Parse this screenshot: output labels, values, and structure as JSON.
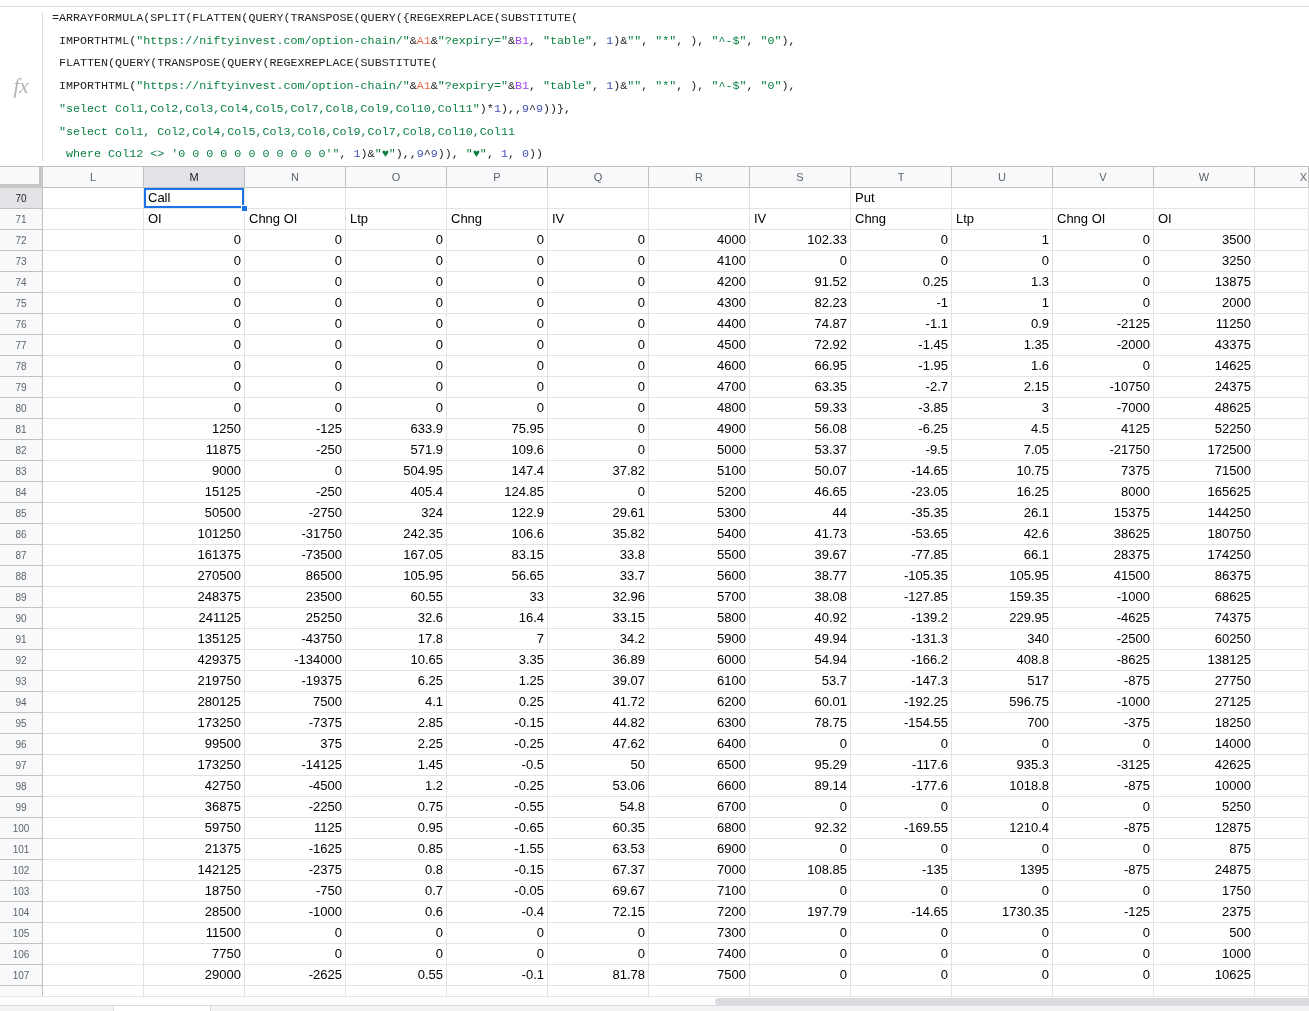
{
  "formula_bar": {
    "label": "fx",
    "lines": [
      "=ARRAYFORMULA(SPLIT(FLATTEN(QUERY(TRANSPOSE(QUERY({REGEXREPLACE(SUBSTITUTE(",
      " IMPORTHTML(\"https://niftyinvest.com/option-chain/\"&A1&\"?expiry=\"&B1, \"table\", 1)&\"\", \"*\", ), \"^-$\", \"0\"),",
      " FLATTEN(QUERY(TRANSPOSE(QUERY(REGEXREPLACE(SUBSTITUTE(",
      " IMPORTHTML(\"https://niftyinvest.com/option-chain/\"&A1&\"?expiry=\"&B1, \"table\", 1)&\"\", \"*\", ), \"^-$\", \"0\"),",
      " \"select Col1,Col2,Col3,Col4,Col5,Col7,Col8,Col9,Col10,Col11\")*1),,9^9))},",
      " \"select Col1, Col2,Col4,Col5,Col3,Col6,Col9,Col7,Col8,Col10,Col11",
      "  where Col12 <> '0 0 0 0 0 0 0 0 0 0 0'\", 1)&\"♥\"),,9^9)), \"♥\", 1, 0))"
    ]
  },
  "sheet": {
    "columns": [
      {
        "label": "L",
        "selected": false
      },
      {
        "label": "M",
        "selected": true
      },
      {
        "label": "N",
        "selected": false
      },
      {
        "label": "O",
        "selected": false
      },
      {
        "label": "P",
        "selected": false
      },
      {
        "label": "Q",
        "selected": false
      },
      {
        "label": "R",
        "selected": false
      },
      {
        "label": "S",
        "selected": false
      },
      {
        "label": "T",
        "selected": false
      },
      {
        "label": "U",
        "selected": false
      },
      {
        "label": "V",
        "selected": false
      },
      {
        "label": "W",
        "selected": false
      },
      {
        "label": "X",
        "selected": false
      }
    ],
    "rows": [
      {
        "label": "70",
        "selected": true,
        "kind": "header",
        "cells": [
          null,
          "Call",
          null,
          null,
          null,
          null,
          null,
          null,
          "Put",
          null,
          null,
          null
        ]
      },
      {
        "label": "71",
        "selected": false,
        "kind": "header",
        "cells": [
          null,
          "OI",
          "Chng OI",
          "Ltp",
          "Chng",
          "IV",
          null,
          "IV",
          "Chng",
          "Ltp",
          "Chng OI",
          "OI"
        ]
      },
      {
        "label": "72",
        "selected": false,
        "kind": "data",
        "cells": [
          null,
          "0",
          "0",
          "0",
          "0",
          "0",
          "4000",
          "102.33",
          "0",
          "1",
          "0",
          "3500"
        ]
      },
      {
        "label": "73",
        "selected": false,
        "kind": "data",
        "cells": [
          null,
          "0",
          "0",
          "0",
          "0",
          "0",
          "4100",
          "0",
          "0",
          "0",
          "0",
          "3250"
        ]
      },
      {
        "label": "74",
        "selected": false,
        "kind": "data",
        "cells": [
          null,
          "0",
          "0",
          "0",
          "0",
          "0",
          "4200",
          "91.52",
          "0.25",
          "1.3",
          "0",
          "13875"
        ]
      },
      {
        "label": "75",
        "selected": false,
        "kind": "data",
        "cells": [
          null,
          "0",
          "0",
          "0",
          "0",
          "0",
          "4300",
          "82.23",
          "-1",
          "1",
          "0",
          "2000"
        ]
      },
      {
        "label": "76",
        "selected": false,
        "kind": "data",
        "cells": [
          null,
          "0",
          "0",
          "0",
          "0",
          "0",
          "4400",
          "74.87",
          "-1.1",
          "0.9",
          "-2125",
          "11250"
        ]
      },
      {
        "label": "77",
        "selected": false,
        "kind": "data",
        "cells": [
          null,
          "0",
          "0",
          "0",
          "0",
          "0",
          "4500",
          "72.92",
          "-1.45",
          "1.35",
          "-2000",
          "43375"
        ]
      },
      {
        "label": "78",
        "selected": false,
        "kind": "data",
        "cells": [
          null,
          "0",
          "0",
          "0",
          "0",
          "0",
          "4600",
          "66.95",
          "-1.95",
          "1.6",
          "0",
          "14625"
        ]
      },
      {
        "label": "79",
        "selected": false,
        "kind": "data",
        "cells": [
          null,
          "0",
          "0",
          "0",
          "0",
          "0",
          "4700",
          "63.35",
          "-2.7",
          "2.15",
          "-10750",
          "24375"
        ]
      },
      {
        "label": "80",
        "selected": false,
        "kind": "data",
        "cells": [
          null,
          "0",
          "0",
          "0",
          "0",
          "0",
          "4800",
          "59.33",
          "-3.85",
          "3",
          "-7000",
          "48625"
        ]
      },
      {
        "label": "81",
        "selected": false,
        "kind": "data",
        "cells": [
          null,
          "1250",
          "-125",
          "633.9",
          "75.95",
          "0",
          "4900",
          "56.08",
          "-6.25",
          "4.5",
          "4125",
          "52250"
        ]
      },
      {
        "label": "82",
        "selected": false,
        "kind": "data",
        "cells": [
          null,
          "11875",
          "-250",
          "571.9",
          "109.6",
          "0",
          "5000",
          "53.37",
          "-9.5",
          "7.05",
          "-21750",
          "172500"
        ]
      },
      {
        "label": "83",
        "selected": false,
        "kind": "data",
        "cells": [
          null,
          "9000",
          "0",
          "504.95",
          "147.4",
          "37.82",
          "5100",
          "50.07",
          "-14.65",
          "10.75",
          "7375",
          "71500"
        ]
      },
      {
        "label": "84",
        "selected": false,
        "kind": "data",
        "cells": [
          null,
          "15125",
          "-250",
          "405.4",
          "124.85",
          "0",
          "5200",
          "46.65",
          "-23.05",
          "16.25",
          "8000",
          "165625"
        ]
      },
      {
        "label": "85",
        "selected": false,
        "kind": "data",
        "cells": [
          null,
          "50500",
          "-2750",
          "324",
          "122.9",
          "29.61",
          "5300",
          "44",
          "-35.35",
          "26.1",
          "15375",
          "144250"
        ]
      },
      {
        "label": "86",
        "selected": false,
        "kind": "data",
        "cells": [
          null,
          "101250",
          "-31750",
          "242.35",
          "106.6",
          "35.82",
          "5400",
          "41.73",
          "-53.65",
          "42.6",
          "38625",
          "180750"
        ]
      },
      {
        "label": "87",
        "selected": false,
        "kind": "data",
        "cells": [
          null,
          "161375",
          "-73500",
          "167.05",
          "83.15",
          "33.8",
          "5500",
          "39.67",
          "-77.85",
          "66.1",
          "28375",
          "174250"
        ]
      },
      {
        "label": "88",
        "selected": false,
        "kind": "data",
        "cells": [
          null,
          "270500",
          "86500",
          "105.95",
          "56.65",
          "33.7",
          "5600",
          "38.77",
          "-105.35",
          "105.95",
          "41500",
          "86375"
        ]
      },
      {
        "label": "89",
        "selected": false,
        "kind": "data",
        "cells": [
          null,
          "248375",
          "23500",
          "60.55",
          "33",
          "32.96",
          "5700",
          "38.08",
          "-127.85",
          "159.35",
          "-1000",
          "68625"
        ]
      },
      {
        "label": "90",
        "selected": false,
        "kind": "data",
        "cells": [
          null,
          "241125",
          "25250",
          "32.6",
          "16.4",
          "33.15",
          "5800",
          "40.92",
          "-139.2",
          "229.95",
          "-4625",
          "74375"
        ]
      },
      {
        "label": "91",
        "selected": false,
        "kind": "data",
        "cells": [
          null,
          "135125",
          "-43750",
          "17.8",
          "7",
          "34.2",
          "5900",
          "49.94",
          "-131.3",
          "340",
          "-2500",
          "60250"
        ]
      },
      {
        "label": "92",
        "selected": false,
        "kind": "data",
        "cells": [
          null,
          "429375",
          "-134000",
          "10.65",
          "3.35",
          "36.89",
          "6000",
          "54.94",
          "-166.2",
          "408.8",
          "-8625",
          "138125"
        ]
      },
      {
        "label": "93",
        "selected": false,
        "kind": "data",
        "cells": [
          null,
          "219750",
          "-19375",
          "6.25",
          "1.25",
          "39.07",
          "6100",
          "53.7",
          "-147.3",
          "517",
          "-875",
          "27750"
        ]
      },
      {
        "label": "94",
        "selected": false,
        "kind": "data",
        "cells": [
          null,
          "280125",
          "7500",
          "4.1",
          "0.25",
          "41.72",
          "6200",
          "60.01",
          "-192.25",
          "596.75",
          "-1000",
          "27125"
        ]
      },
      {
        "label": "95",
        "selected": false,
        "kind": "data",
        "cells": [
          null,
          "173250",
          "-7375",
          "2.85",
          "-0.15",
          "44.82",
          "6300",
          "78.75",
          "-154.55",
          "700",
          "-375",
          "18250"
        ]
      },
      {
        "label": "96",
        "selected": false,
        "kind": "data",
        "cells": [
          null,
          "99500",
          "375",
          "2.25",
          "-0.25",
          "47.62",
          "6400",
          "0",
          "0",
          "0",
          "0",
          "14000"
        ]
      },
      {
        "label": "97",
        "selected": false,
        "kind": "data",
        "cells": [
          null,
          "173250",
          "-14125",
          "1.45",
          "-0.5",
          "50",
          "6500",
          "95.29",
          "-117.6",
          "935.3",
          "-3125",
          "42625"
        ]
      },
      {
        "label": "98",
        "selected": false,
        "kind": "data",
        "cells": [
          null,
          "42750",
          "-4500",
          "1.2",
          "-0.25",
          "53.06",
          "6600",
          "89.14",
          "-177.6",
          "1018.8",
          "-875",
          "10000"
        ]
      },
      {
        "label": "99",
        "selected": false,
        "kind": "data",
        "cells": [
          null,
          "36875",
          "-2250",
          "0.75",
          "-0.55",
          "54.8",
          "6700",
          "0",
          "0",
          "0",
          "0",
          "5250"
        ]
      },
      {
        "label": "100",
        "selected": false,
        "kind": "data",
        "cells": [
          null,
          "59750",
          "1125",
          "0.95",
          "-0.65",
          "60.35",
          "6800",
          "92.32",
          "-169.55",
          "1210.4",
          "-875",
          "12875"
        ]
      },
      {
        "label": "101",
        "selected": false,
        "kind": "data",
        "cells": [
          null,
          "21375",
          "-1625",
          "0.85",
          "-1.55",
          "63.53",
          "6900",
          "0",
          "0",
          "0",
          "0",
          "875"
        ]
      },
      {
        "label": "102",
        "selected": false,
        "kind": "data",
        "cells": [
          null,
          "142125",
          "-2375",
          "0.8",
          "-0.15",
          "67.37",
          "7000",
          "108.85",
          "-135",
          "1395",
          "-875",
          "24875"
        ]
      },
      {
        "label": "103",
        "selected": false,
        "kind": "data",
        "cells": [
          null,
          "18750",
          "-750",
          "0.7",
          "-0.05",
          "69.67",
          "7100",
          "0",
          "0",
          "0",
          "0",
          "1750"
        ]
      },
      {
        "label": "104",
        "selected": false,
        "kind": "data",
        "cells": [
          null,
          "28500",
          "-1000",
          "0.6",
          "-0.4",
          "72.15",
          "7200",
          "197.79",
          "-14.65",
          "1730.35",
          "-125",
          "2375"
        ]
      },
      {
        "label": "105",
        "selected": false,
        "kind": "data",
        "cells": [
          null,
          "11500",
          "0",
          "0",
          "0",
          "0",
          "7300",
          "0",
          "0",
          "0",
          "0",
          "500"
        ]
      },
      {
        "label": "106",
        "selected": false,
        "kind": "data",
        "cells": [
          null,
          "7750",
          "0",
          "0",
          "0",
          "0",
          "7400",
          "0",
          "0",
          "0",
          "0",
          "1000"
        ]
      },
      {
        "label": "107",
        "selected": false,
        "kind": "data",
        "cells": [
          null,
          "29000",
          "-2625",
          "0.55",
          "-0.1",
          "81.78",
          "7500",
          "0",
          "0",
          "0",
          "0",
          "10625"
        ]
      }
    ]
  }
}
